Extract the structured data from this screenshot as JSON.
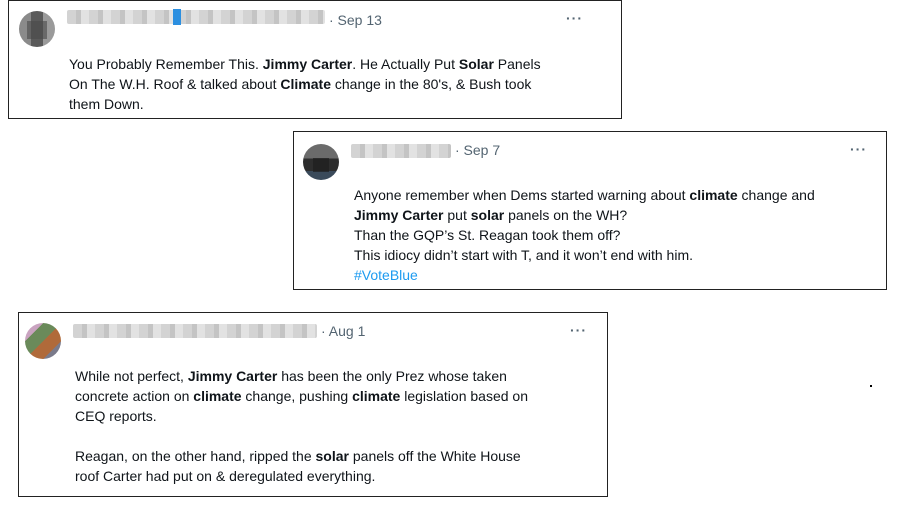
{
  "tweets": [
    {
      "date": "· Sep 13",
      "more": "···",
      "lines": [
        [
          {
            "t": "You Probably Remember This. ",
            "b": false
          },
          {
            "t": "Jimmy Carter",
            "b": true
          },
          {
            "t": ". He Actually Put ",
            "b": false
          },
          {
            "t": "Solar",
            "b": true
          },
          {
            "t": " Panels",
            "b": false
          }
        ],
        [
          {
            "t": "On The W.H. Roof & talked about ",
            "b": false
          },
          {
            "t": "Climate",
            "b": true
          },
          {
            "t": " change in the 80's, & Bush took",
            "b": false
          }
        ],
        [
          {
            "t": "them Down.",
            "b": false
          }
        ]
      ]
    },
    {
      "date": "· Sep 7",
      "more": "···",
      "lines": [
        [
          {
            "t": "Anyone remember when Dems started warning about ",
            "b": false
          },
          {
            "t": "climate",
            "b": true
          },
          {
            "t": " change and",
            "b": false
          }
        ],
        [
          {
            "t": "Jimmy Carter",
            "b": true
          },
          {
            "t": " put ",
            "b": false
          },
          {
            "t": "solar",
            "b": true
          },
          {
            "t": " panels on the WH?",
            "b": false
          }
        ],
        [
          {
            "t": "Than the GQP’s St. Reagan took them off?",
            "b": false
          }
        ],
        [
          {
            "t": "This idiocy didn’t start with T, and it won’t end with him.",
            "b": false
          }
        ],
        [
          {
            "t": "#VoteBlue",
            "b": false,
            "tag": true
          }
        ]
      ]
    },
    {
      "date": "· Aug 1",
      "more": "···",
      "lines": [
        [
          {
            "t": "While not perfect, ",
            "b": false
          },
          {
            "t": "Jimmy Carter",
            "b": true
          },
          {
            "t": " has been the only Prez whose taken",
            "b": false
          }
        ],
        [
          {
            "t": "concrete action on ",
            "b": false
          },
          {
            "t": "climate",
            "b": true
          },
          {
            "t": " change, pushing ",
            "b": false
          },
          {
            "t": "climate",
            "b": true
          },
          {
            "t": " legislation based on",
            "b": false
          }
        ],
        [
          {
            "t": "CEQ reports.",
            "b": false
          }
        ],
        [],
        [
          {
            "t": "Reagan, on the other hand, ripped the ",
            "b": false
          },
          {
            "t": "solar",
            "b": true
          },
          {
            "t": " panels off the White House",
            "b": false
          }
        ],
        [
          {
            "t": "roof Carter had put on & deregulated everything.",
            "b": false
          }
        ]
      ]
    }
  ]
}
